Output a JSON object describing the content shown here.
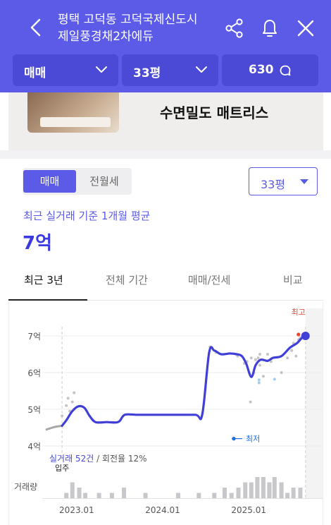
{
  "header": {
    "title_line1": "평택 고덕동 고덕국제신도시",
    "title_line2": "제일풍경채2차에듀",
    "icons": [
      "back-arrow-icon",
      "share-icon",
      "bell-icon",
      "close-icon"
    ]
  },
  "filters": {
    "deal_type": "매매",
    "size": "33평",
    "count": "630"
  },
  "banner": {
    "text": "수면밀도 매트리스"
  },
  "controls": {
    "segment_active": "매매",
    "segment_inactive": "전월세",
    "size_select": "33평"
  },
  "summary": {
    "label": "최근 실거래 기준 1개월 평균",
    "value": "7억"
  },
  "tabs": [
    {
      "label": "최근 3년",
      "active": true
    },
    {
      "label": "전체 기간",
      "active": false
    },
    {
      "label": "매매/전세",
      "active": false
    },
    {
      "label": "비교",
      "active": false
    }
  ],
  "colors": {
    "brand": "#5b5be8",
    "line": "#4040d8",
    "high": "#e34a34",
    "low": "#1a6ee8",
    "dot": "#c4c4c8"
  },
  "chart_data": {
    "type": "line",
    "y_ticks": [
      "7억",
      "6억",
      "5억",
      "4억"
    ],
    "y_values": [
      7,
      6,
      5,
      4
    ],
    "ylim": [
      4,
      7.25
    ],
    "x_ticks": [
      "2023.01",
      "2024.01",
      "2025.01"
    ],
    "x_tick_values": [
      2023.0,
      2024.0,
      2025.0
    ],
    "xlim": [
      2022.6,
      2025.85
    ],
    "grid": true,
    "high_label": "최고",
    "low_label": "최저",
    "move_in_label": "입주",
    "move_in_x": 2022.83,
    "stats_count": "실거래 52건",
    "stats_rest": " / 회전율 12%",
    "volume_label": "거래량",
    "pre_series": [
      [
        2022.65,
        4.45
      ],
      [
        2022.75,
        4.52
      ],
      [
        2022.83,
        4.55
      ]
    ],
    "series": [
      [
        2022.83,
        4.55
      ],
      [
        2022.88,
        4.7
      ],
      [
        2022.95,
        4.95
      ],
      [
        2023.02,
        5.08
      ],
      [
        2023.09,
        5.04
      ],
      [
        2023.15,
        4.82
      ],
      [
        2023.22,
        4.65
      ],
      [
        2023.35,
        4.65
      ],
      [
        2023.45,
        4.64
      ],
      [
        2023.5,
        4.68
      ],
      [
        2023.56,
        4.85
      ],
      [
        2023.7,
        4.85
      ],
      [
        2023.9,
        4.85
      ],
      [
        2024.1,
        4.85
      ],
      [
        2024.38,
        4.85
      ],
      [
        2024.46,
        4.86
      ],
      [
        2024.54,
        6.55
      ],
      [
        2024.6,
        6.6
      ],
      [
        2024.68,
        6.5
      ],
      [
        2024.78,
        6.52
      ],
      [
        2024.86,
        6.5
      ],
      [
        2024.92,
        6.45
      ],
      [
        2024.97,
        6.25
      ],
      [
        2025.03,
        5.88
      ],
      [
        2025.08,
        6.2
      ],
      [
        2025.14,
        6.35
      ],
      [
        2025.22,
        6.32
      ],
      [
        2025.28,
        6.4
      ],
      [
        2025.38,
        6.45
      ],
      [
        2025.48,
        6.68
      ],
      [
        2025.56,
        6.8
      ],
      [
        2025.62,
        6.95
      ],
      [
        2025.66,
        7.0
      ]
    ],
    "high_point": [
      2025.66,
      7.0
    ],
    "low_marker_y": 4.2,
    "scatter": [
      [
        2022.83,
        4.82
      ],
      [
        2022.88,
        5.1
      ],
      [
        2022.9,
        5.3
      ],
      [
        2022.92,
        4.95
      ],
      [
        2022.97,
        5.45
      ],
      [
        2022.95,
        5.2
      ],
      [
        2024.55,
        6.7
      ],
      [
        2024.62,
        6.55
      ],
      [
        2024.87,
        6.45
      ],
      [
        2024.95,
        6.25
      ],
      [
        2024.98,
        6.3
      ],
      [
        2025.02,
        5.2
      ],
      [
        2025.03,
        6.4
      ],
      [
        2025.06,
        6.0
      ],
      [
        2025.08,
        6.35
      ],
      [
        2025.11,
        6.4
      ],
      [
        2025.13,
        6.5
      ],
      [
        2025.13,
        6.2
      ],
      [
        2025.17,
        5.9
      ],
      [
        2025.22,
        6.5
      ],
      [
        2025.26,
        6.3
      ],
      [
        2025.38,
        6.0
      ],
      [
        2025.45,
        6.4
      ],
      [
        2025.5,
        6.6
      ],
      [
        2025.52,
        6.8
      ],
      [
        2025.55,
        6.45
      ],
      [
        2025.58,
        6.9
      ],
      [
        2025.6,
        6.95
      ]
    ],
    "scatter_low": [
      [
        2025.12,
        5.8
      ],
      [
        2025.12,
        5.72
      ],
      [
        2025.3,
        5.82
      ]
    ],
    "volume": [
      [
        2022.88,
        1
      ],
      [
        2022.95,
        3
      ],
      [
        2023.03,
        2
      ],
      [
        2023.1,
        1
      ],
      [
        2023.26,
        1
      ],
      [
        2023.41,
        1
      ],
      [
        2023.55,
        2
      ],
      [
        2023.8,
        1
      ],
      [
        2024.18,
        1
      ],
      [
        2024.42,
        1
      ],
      [
        2024.6,
        1
      ],
      [
        2024.72,
        2
      ],
      [
        2024.8,
        1
      ],
      [
        2024.88,
        2
      ],
      [
        2024.96,
        3
      ],
      [
        2025.03,
        3
      ],
      [
        2025.1,
        4
      ],
      [
        2025.17,
        4
      ],
      [
        2025.24,
        3
      ],
      [
        2025.3,
        4
      ],
      [
        2025.38,
        3
      ],
      [
        2025.45,
        1
      ],
      [
        2025.52,
        2
      ],
      [
        2025.6,
        2
      ]
    ]
  }
}
